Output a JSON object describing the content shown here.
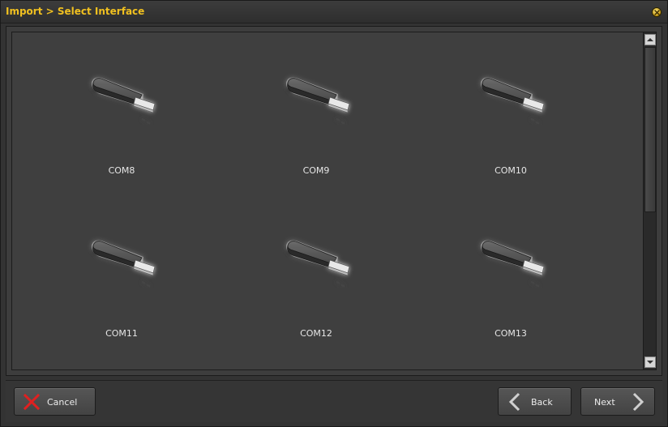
{
  "window": {
    "title": "Import > Select Interface"
  },
  "interfaces": [
    {
      "label": "COM8"
    },
    {
      "label": "COM9"
    },
    {
      "label": "COM10"
    },
    {
      "label": "COM11"
    },
    {
      "label": "COM12"
    },
    {
      "label": "COM13"
    }
  ],
  "icons": {
    "interface": "usb-stick-icon",
    "close": "close-icon",
    "cancel": "red-x-icon",
    "back": "chevron-left-icon",
    "next": "chevron-right-icon"
  },
  "footer": {
    "cancel_label": "Cancel",
    "back_label": "Back",
    "next_label": "Next"
  },
  "colors": {
    "title": "#f0c020",
    "cancel_icon": "#e02020",
    "background": "#3f3f3f"
  }
}
